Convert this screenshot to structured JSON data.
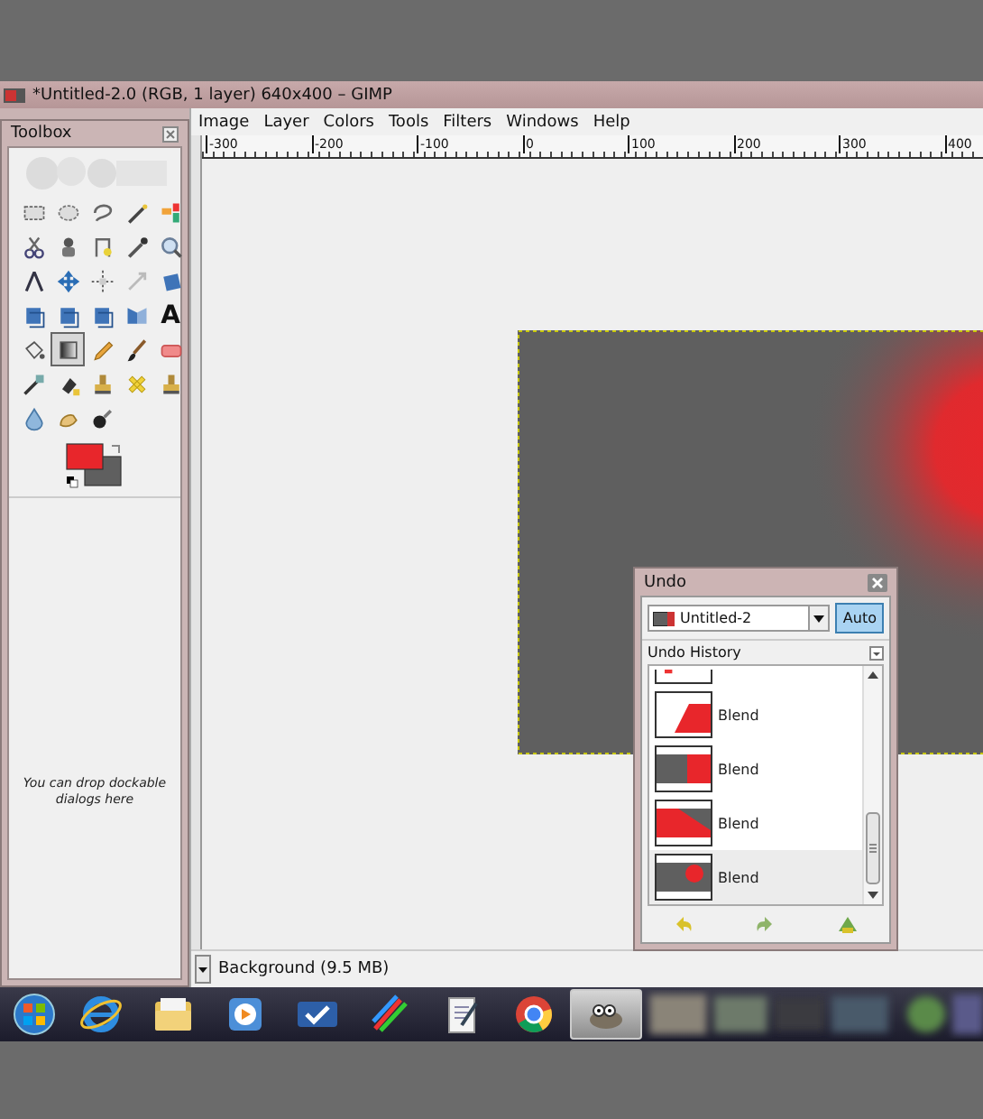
{
  "window": {
    "title": "*Untitled-2.0 (RGB, 1 layer) 640x400 – GIMP"
  },
  "menu": [
    "Image",
    "Layer",
    "Colors",
    "Tools",
    "Filters",
    "Windows",
    "Help"
  ],
  "ruler": [
    "-300",
    "-200",
    "-100",
    "0",
    "100",
    "200",
    "300",
    "400"
  ],
  "toolbox": {
    "title": "Toolbox",
    "tools": [
      {
        "selected": false
      },
      {
        "selected": false
      },
      {
        "selected": false
      },
      {
        "selected": false
      },
      {
        "selected": false
      },
      {
        "selected": false
      },
      {
        "selected": false
      },
      {
        "selected": false
      },
      {
        "selected": false
      },
      {
        "selected": false
      },
      {
        "selected": false
      },
      {
        "selected": false
      },
      {
        "selected": false
      },
      {
        "selected": false
      },
      {
        "selected": false
      },
      {
        "selected": false
      },
      {
        "selected": false
      },
      {
        "selected": false
      },
      {
        "selected": false
      },
      {
        "selected": false,
        "glyph": "A"
      },
      {
        "selected": false
      },
      {
        "selected": true
      },
      {
        "selected": false
      },
      {
        "selected": false
      },
      {
        "selected": false
      },
      {
        "selected": false
      },
      {
        "selected": false
      },
      {
        "selected": false
      },
      {
        "selected": false
      },
      {
        "selected": false
      },
      {
        "selected": false
      },
      {
        "selected": false
      },
      {
        "selected": false
      }
    ],
    "hint": "You can drop dockable dialogs here"
  },
  "status": {
    "layer": "Background (9.5 MB)"
  },
  "undo": {
    "title": "Undo",
    "image": "Untitled-2",
    "auto": {
      "label": "Auto",
      "pressed": true
    },
    "history_title": "Undo History",
    "items": [
      {
        "kind": "cut",
        "selected": false
      },
      {
        "kind": "corner",
        "label": "Blend",
        "selected": false
      },
      {
        "kind": "right",
        "label": "Blend",
        "selected": false
      },
      {
        "kind": "diagonal",
        "label": "Blend",
        "selected": false
      },
      {
        "kind": "spot",
        "label": "Blend",
        "selected": true
      }
    ]
  },
  "taskbar": [
    {
      "kind": "start",
      "selected": false
    },
    {
      "kind": "browser",
      "selected": false
    },
    {
      "kind": "folder",
      "selected": false
    },
    {
      "kind": "media",
      "selected": false
    },
    {
      "kind": "tasks",
      "selected": false
    },
    {
      "kind": "paint",
      "selected": false
    },
    {
      "kind": "notepad",
      "selected": false
    },
    {
      "kind": "chrome",
      "selected": false
    },
    {
      "kind": "gimp",
      "selected": true
    }
  ]
}
